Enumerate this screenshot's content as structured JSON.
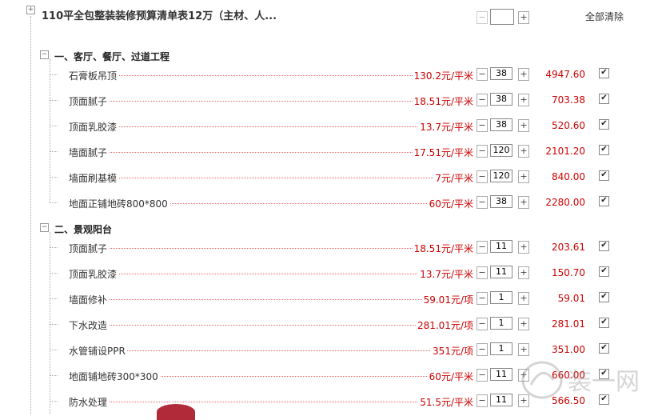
{
  "header": {
    "title": "110平全包整装装修预算清单表12万（主材、人...",
    "expand_symbol": "+",
    "minus_label": "−",
    "plus_label": "+",
    "qty_value": "",
    "clear_all": "全部清除"
  },
  "sections": [
    {
      "title": "一、客厅、餐厅、过道工程",
      "toggle": "−",
      "items": [
        {
          "name": "石膏板吊顶",
          "price": "130.2元/平米",
          "qty": "38",
          "total": "4947.60",
          "checked": "✔"
        },
        {
          "name": "顶面腻子",
          "price": "18.51元/平米",
          "qty": "38",
          "total": "703.38",
          "checked": "✔"
        },
        {
          "name": "顶面乳胶漆",
          "price": "13.7元/平米",
          "qty": "38",
          "total": "520.60",
          "checked": "✔"
        },
        {
          "name": "墙面腻子",
          "price": "17.51元/平米",
          "qty": "120",
          "total": "2101.20",
          "checked": "✔"
        },
        {
          "name": "墙面刷基模",
          "price": "7元/平米",
          "qty": "120",
          "total": "840.00",
          "checked": "✔"
        },
        {
          "name": "地面正铺地砖800*800",
          "price": "60元/平米",
          "qty": "38",
          "total": "2280.00",
          "checked": "✔"
        }
      ]
    },
    {
      "title": "二、景观阳台",
      "toggle": "−",
      "items": [
        {
          "name": "顶面腻子",
          "price": "18.51元/平米",
          "qty": "11",
          "total": "203.61",
          "checked": "✔"
        },
        {
          "name": "顶面乳胶漆",
          "price": "13.7元/平米",
          "qty": "11",
          "total": "150.70",
          "checked": "✔"
        },
        {
          "name": "墙面修补",
          "price": "59.01元/项",
          "qty": "1",
          "total": "59.01",
          "checked": "✔"
        },
        {
          "name": "下水改造",
          "price": "281.01元/项",
          "qty": "1",
          "total": "281.01",
          "checked": "✔"
        },
        {
          "name": "水管铺设PPR",
          "price": "351元/项",
          "qty": "1",
          "total": "351.00",
          "checked": "✔"
        },
        {
          "name": "地面铺地砖300*300",
          "price": "60元/平米",
          "qty": "11",
          "total": "660.00",
          "checked": "✔"
        },
        {
          "name": "防水处理",
          "price": "51.5元/平米",
          "qty": "11",
          "total": "566.50",
          "checked": "✔"
        }
      ]
    }
  ],
  "watermark": {
    "text": "装一网"
  }
}
